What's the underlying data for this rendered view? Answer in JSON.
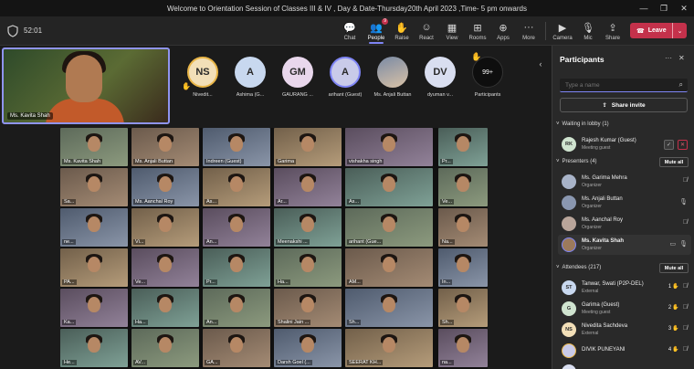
{
  "window": {
    "title": "Welcome to Orientation Session of Classes III & IV , Day & Date-Thursday20th April 2023 ,Time- 5 pm onwards",
    "controls": [
      "—",
      "❐",
      "✕"
    ]
  },
  "toolbar": {
    "timer": "52:01",
    "buttons": [
      {
        "label": "Chat",
        "icon": "chat-icon",
        "glyph": "💬"
      },
      {
        "label": "People",
        "icon": "people-icon",
        "glyph": "👥",
        "badge": "9"
      },
      {
        "label": "Raise",
        "icon": "raise-hand-icon",
        "glyph": "✋"
      },
      {
        "label": "React",
        "icon": "react-icon",
        "glyph": "☺"
      },
      {
        "label": "View",
        "icon": "view-icon",
        "glyph": "▦"
      },
      {
        "label": "Rooms",
        "icon": "rooms-icon",
        "glyph": "⊞"
      },
      {
        "label": "Apps",
        "icon": "apps-icon",
        "glyph": "⊕"
      },
      {
        "label": "More",
        "icon": "more-icon",
        "glyph": "···"
      },
      {
        "label": "Camera",
        "icon": "camera-icon",
        "glyph": "▶"
      },
      {
        "label": "Mic",
        "icon": "mic-icon",
        "glyph": "🎙"
      },
      {
        "label": "Share",
        "icon": "share-icon",
        "glyph": "⇪"
      }
    ],
    "leave_label": "Leave",
    "leave_color": "#c4314b",
    "accent": "#7f85f5"
  },
  "self_view": {
    "name": "Ms. Kavita Shah"
  },
  "avatars": [
    {
      "initials": "NS",
      "label": "Nivedit...",
      "color": "#f2dfb8",
      "raised": true
    },
    {
      "initials": "A",
      "label": "Ashima (G...",
      "color": "#c8d8ef"
    },
    {
      "initials": "GM",
      "label": "GAURANG ...",
      "color": "#e9d7ec"
    },
    {
      "initials": "A",
      "label": "arihant (Guest)",
      "color": "#c9cbe9"
    },
    {
      "initials": "",
      "label": "Ms. Anjali Buttan",
      "color": "#8a97b0"
    },
    {
      "initials": "DV",
      "label": "dyuman v...",
      "color": "#d9def0"
    }
  ],
  "more_participants": {
    "count": "99+",
    "label": "Participants"
  },
  "share_tiles": [
    "Ms. Kavita Shah",
    "Ms. Anjali Buttan",
    "Indreen (Guest)",
    "Garima",
    "vishakha singh",
    "Pr...",
    "Sa...",
    "Ms. Aanchal Roy",
    "As...",
    "Ar...",
    "As...",
    "Ve...",
    "ne...",
    "Vi...",
    "An...",
    "Meenakshi ...",
    "arihant (Gue...",
    "Na...",
    "PA...",
    "Ve...",
    "Pr...",
    "Ha...",
    "AM...",
    "In...",
    "Ka...",
    "Ha...",
    "An...",
    "Shalini Jain ...",
    "Sh...",
    "Sh...",
    "He...",
    "AV...",
    "GA...",
    "Darsh Goel (...",
    "SEERAT KH...",
    "na..."
  ],
  "panel": {
    "title": "Participants",
    "search_placeholder": "Type a name",
    "share_invite_label": "Share invite",
    "waiting_section": "Waiting in lobby (1)",
    "waiting": [
      {
        "initials": "RK",
        "name": "Rajesh Kumar (Guest)",
        "role": "Meeting guest",
        "color": "#cfe3cf"
      }
    ],
    "presenters_section": "Presenters (4)",
    "mute_all_label": "Mute all",
    "presenters": [
      {
        "name": "Ms. Garima Mehra",
        "role": "Organizer",
        "color": "#a8b3c8"
      },
      {
        "name": "Ms. Anjali Buttan",
        "role": "Organizer",
        "color": "#8a97b0"
      },
      {
        "name": "Ms. Aanchal Roy",
        "role": "Organizer",
        "color": "#b9a59a"
      },
      {
        "name": "Ms. Kavita Shah",
        "role": "Organizer",
        "color": "#9c7a5c"
      }
    ],
    "attendees_section": "Attendees (217)",
    "attendees": [
      {
        "initials": "ST",
        "name": "Tanwar, Swati (P2P-DEL)",
        "role": "External",
        "color": "#c8d8ef",
        "hand": "1"
      },
      {
        "initials": "G",
        "name": "Garima (Guest)",
        "role": "Meeting guest",
        "color": "#cfe3cf",
        "hand": "2"
      },
      {
        "initials": "NS",
        "name": "Nivedita Sachdeva",
        "role": "External",
        "color": "#f2dfb8",
        "hand": "3"
      },
      {
        "initials": "",
        "name": "DIVIK PUNEYANI",
        "role": "",
        "color": "#c9cbe9",
        "hand": "4"
      }
    ]
  }
}
